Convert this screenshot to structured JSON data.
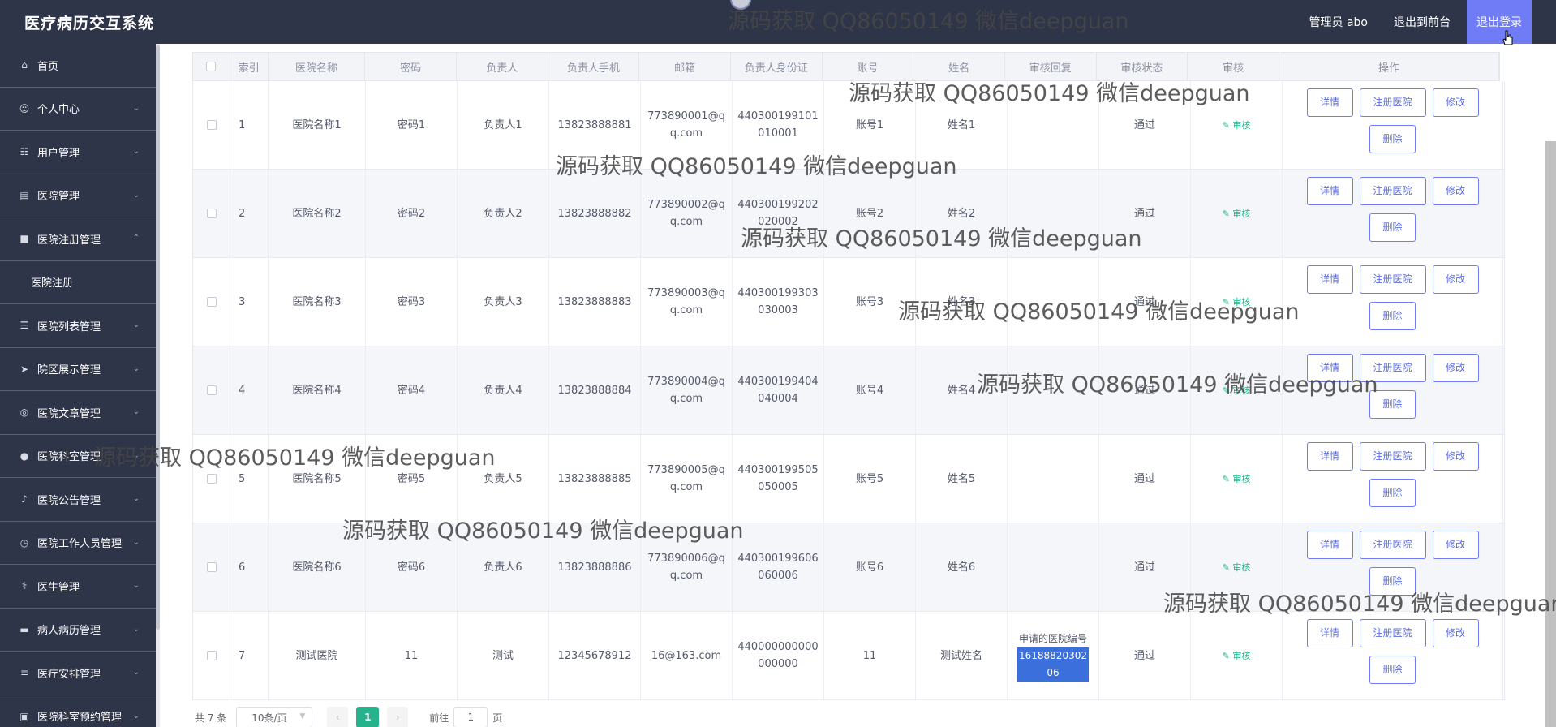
{
  "app": {
    "title": "医疗病历交互系统",
    "user": "管理员 abo",
    "goto_front": "退出到前台",
    "logout": "退出登录"
  },
  "sidebar": {
    "items": [
      {
        "label": "首页",
        "icon": "home-icon",
        "chevron": false
      },
      {
        "label": "个人中心",
        "icon": "user-icon",
        "chevron": true
      },
      {
        "label": "用户管理",
        "icon": "users-icon",
        "chevron": true
      },
      {
        "label": "医院管理",
        "icon": "briefcase-icon",
        "chevron": true
      },
      {
        "label": "医院注册管理",
        "icon": "form-icon",
        "chevron": true,
        "expanded": true
      },
      {
        "label": "医院列表管理",
        "icon": "list-icon",
        "chevron": true
      },
      {
        "label": "院区展示管理",
        "icon": "send-icon",
        "chevron": true
      },
      {
        "label": "医院文章管理",
        "icon": "target-icon",
        "chevron": true
      },
      {
        "label": "医院科室管理",
        "icon": "pin-icon",
        "chevron": true
      },
      {
        "label": "医院公告管理",
        "icon": "bell-icon",
        "chevron": true
      },
      {
        "label": "医院工作人员管理",
        "icon": "clock-icon",
        "chevron": true
      },
      {
        "label": "医生管理",
        "icon": "doctor-icon",
        "chevron": true
      },
      {
        "label": "病人病历管理",
        "icon": "car-icon",
        "chevron": true
      },
      {
        "label": "医疗安排管理",
        "icon": "sliders-icon",
        "chevron": true
      },
      {
        "label": "医院科室预约管理",
        "icon": "image-icon",
        "chevron": true
      }
    ],
    "sub_item": "医院注册"
  },
  "table": {
    "headers": [
      "",
      "索引",
      "医院名称",
      "密码",
      "负责人",
      "负责人手机",
      "邮箱",
      "负责人身份证",
      "账号",
      "姓名",
      "审核回复",
      "审核状态",
      "审核",
      "操作"
    ],
    "rows": [
      {
        "idx": "1",
        "name": "医院名称1",
        "pwd": "密码1",
        "owner": "负责人1",
        "phone": "13823888881",
        "email": "773890001@qq.com",
        "idcard": "440300199101010001",
        "account": "账号1",
        "realname": "姓名1",
        "reply": "",
        "status": "通过",
        "audit": "审核"
      },
      {
        "idx": "2",
        "name": "医院名称2",
        "pwd": "密码2",
        "owner": "负责人2",
        "phone": "13823888882",
        "email": "773890002@qq.com",
        "idcard": "440300199202020002",
        "account": "账号2",
        "realname": "姓名2",
        "reply": "",
        "status": "通过",
        "audit": "审核"
      },
      {
        "idx": "3",
        "name": "医院名称3",
        "pwd": "密码3",
        "owner": "负责人3",
        "phone": "13823888883",
        "email": "773890003@qq.com",
        "idcard": "440300199303030003",
        "account": "账号3",
        "realname": "姓名3",
        "reply": "",
        "status": "通过",
        "audit": "审核"
      },
      {
        "idx": "4",
        "name": "医院名称4",
        "pwd": "密码4",
        "owner": "负责人4",
        "phone": "13823888884",
        "email": "773890004@qq.com",
        "idcard": "440300199404040004",
        "account": "账号4",
        "realname": "姓名4",
        "reply": "",
        "status": "通过",
        "audit": "审核"
      },
      {
        "idx": "5",
        "name": "医院名称5",
        "pwd": "密码5",
        "owner": "负责人5",
        "phone": "13823888885",
        "email": "773890005@qq.com",
        "idcard": "440300199505050005",
        "account": "账号5",
        "realname": "姓名5",
        "reply": "",
        "status": "通过",
        "audit": "审核"
      },
      {
        "idx": "6",
        "name": "医院名称6",
        "pwd": "密码6",
        "owner": "负责人6",
        "phone": "13823888886",
        "email": "773890006@qq.com",
        "idcard": "440300199606060006",
        "account": "账号6",
        "realname": "姓名6",
        "reply": "",
        "status": "通过",
        "audit": "审核"
      },
      {
        "idx": "7",
        "name": "测试医院",
        "pwd": "11",
        "owner": "测试",
        "phone": "12345678912",
        "email": "16@163.com",
        "idcard": "440000000000000000",
        "account": "11",
        "realname": "测试姓名",
        "reply_label": "申请的医院编号",
        "reply_value": "1618882030206",
        "status": "通过",
        "audit": "审核"
      }
    ],
    "actions": {
      "detail": "详情",
      "register": "注册医院",
      "edit": "修改",
      "delete": "删除"
    }
  },
  "pager": {
    "total": "共 7 条",
    "page_size": "10条/页",
    "current": "1",
    "goto_label": "前往",
    "goto_value": "1",
    "page_unit": "页"
  },
  "watermark": "源码获取 QQ86050149 微信deepguan",
  "colors": {
    "header_bg": "#2f3549",
    "logout_bg": "#6f7cf5",
    "accent_green": "#26b38b",
    "button_border": "#6f7cf5"
  }
}
